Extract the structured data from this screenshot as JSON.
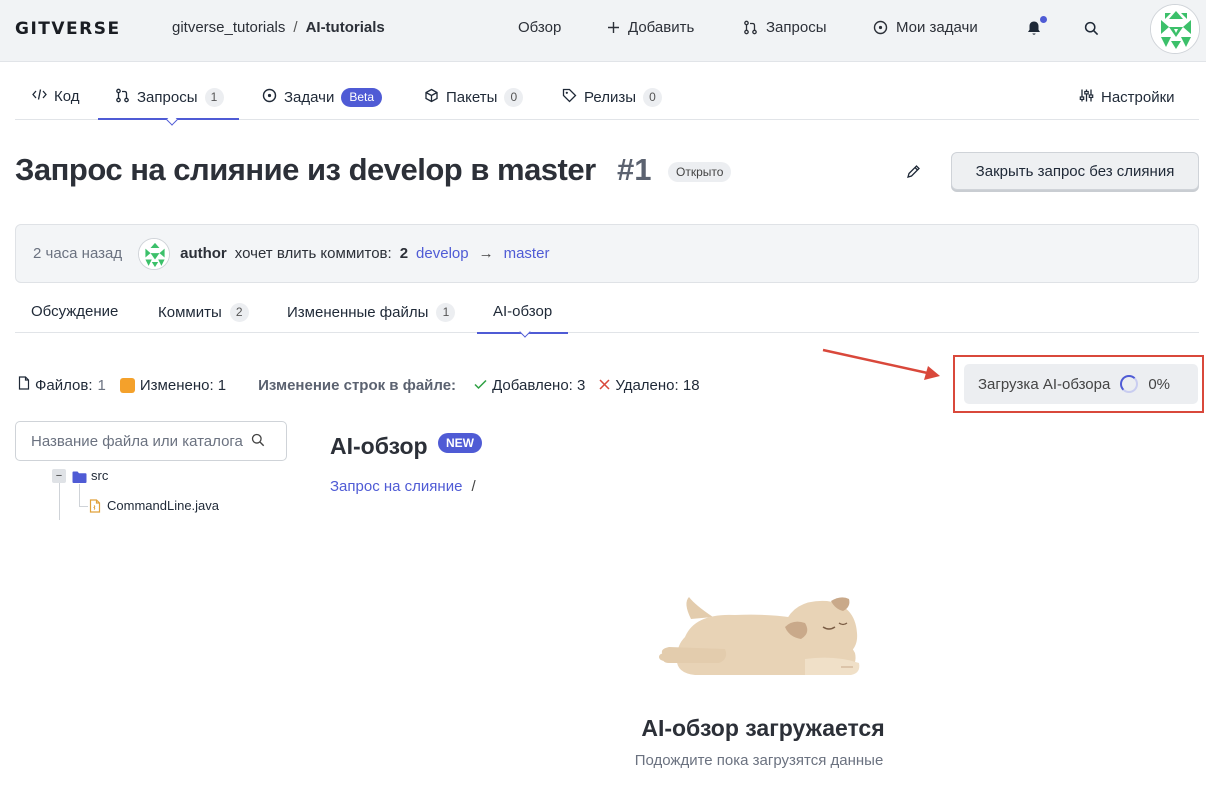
{
  "header": {
    "logo": "GITVERSE",
    "breadcrumb": {
      "owner": "gitverse_tutorials",
      "sep": "/",
      "repo": "AI-tutorials"
    },
    "nav": {
      "overview": "Обзор",
      "add": "Добавить",
      "requests": "Запросы",
      "my_tasks": "Мои задачи"
    }
  },
  "repo_tabs": [
    {
      "label": "Код"
    },
    {
      "label": "Запросы",
      "count": "1"
    },
    {
      "label": "Задачи",
      "badge": "Beta"
    },
    {
      "label": "Пакеты",
      "count": "0"
    },
    {
      "label": "Релизы",
      "count": "0"
    },
    {
      "label": "Настройки"
    }
  ],
  "pr": {
    "title": "Запрос на слияние из develop в master",
    "number": "#1",
    "status": "Открыто",
    "close_button": "Закрыть запрос без слияния",
    "time": "2 часа назад",
    "author": "author",
    "wants_text": "хочет влить коммитов:",
    "commit_count": "2",
    "source_branch": "develop",
    "arrow": "→",
    "target_branch": "master"
  },
  "pr_tabs": [
    {
      "label": "Обсуждение"
    },
    {
      "label": "Коммиты",
      "count": "2"
    },
    {
      "label": "Измененные файлы",
      "count": "1"
    },
    {
      "label": "AI-обзор"
    }
  ],
  "stats": {
    "files_label": "Файлов:",
    "files_value": "1",
    "changed_label": "Изменено: 1",
    "lines_label": "Изменение строк в файле:",
    "added": "Добавлено: 3",
    "deleted": "Удалено: 18"
  },
  "ai_loading": {
    "label": "Загрузка AI-обзора",
    "percent": "0%"
  },
  "sidebar": {
    "search_placeholder": "Название файла или каталога",
    "collapse": "−",
    "folder": "src",
    "file": "CommandLine.java"
  },
  "ai_review": {
    "heading": "AI-обзор",
    "badge": "NEW",
    "crumb_link": "Запрос на слияние",
    "crumb_sep": "/",
    "loading_title": "AI-обзор загружается",
    "loading_subtitle": "Подождите пока загрузятся данные"
  },
  "colors": {
    "accent": "#4f5bd5",
    "annotation": "#d9483b",
    "changed": "#f4a12b",
    "added": "#2ea043",
    "deleted": "#d9483b"
  }
}
